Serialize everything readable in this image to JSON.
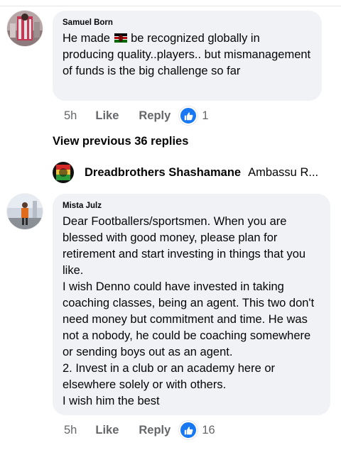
{
  "comments": [
    {
      "author": "Samuel Born",
      "text_before_flag": "He made ",
      "flag_icon": "kenya-flag",
      "text_after_flag": " be recognized globally in producing quality..players.. but mismanagement of funds is the big challenge so far",
      "time": "5h",
      "like_label": "Like",
      "reply_label": "Reply",
      "reaction_count": "1"
    },
    {
      "author": "Mista Julz",
      "text": "Dear Footballers/sportsmen. When you are blessed with good money, please plan for retirement and start investing in things that you like.\nI wish Denno could have invested in taking coaching classes, being an agent. This two don't need money but commitment and time. He was not a nobody, he could be coaching somewhere or sending boys out as an agent.\n2. Invest in a club or an academy here or elsewhere solely or with others.\nI wish him the best",
      "time": "5h",
      "like_label": "Like",
      "reply_label": "Reply",
      "reaction_count": "16"
    }
  ],
  "view_previous_replies": "View previous 36 replies",
  "reply_preview": {
    "author": "Dreadbrothers Shashamane",
    "text": "Ambassu R..."
  },
  "colors": {
    "bubble": "#f0f2f5",
    "meta_text": "#65676b",
    "like_blue": "#1877f2"
  }
}
